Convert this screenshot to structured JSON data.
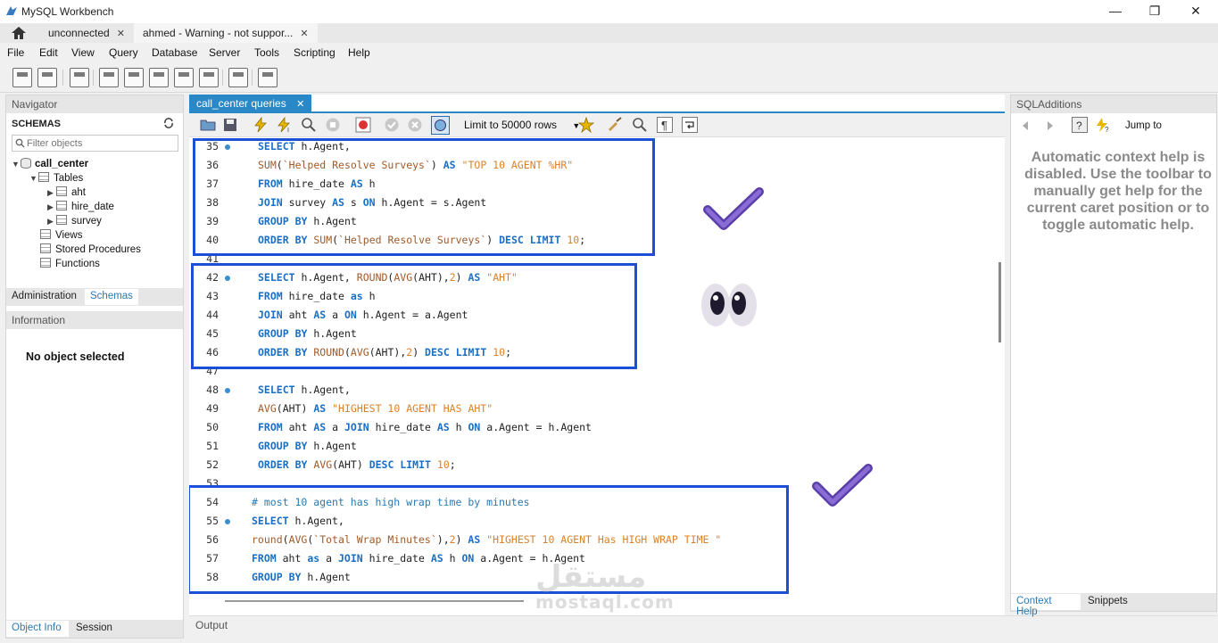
{
  "window": {
    "title": "MySQL Workbench",
    "controls": {
      "minimize": "—",
      "maximize": "❐",
      "close": "✕"
    }
  },
  "connection_tabs": [
    {
      "label": "unconnected",
      "close": "✕"
    },
    {
      "label": "ahmed - Warning - not suppor...",
      "close": "✕"
    }
  ],
  "menu": [
    "File",
    "Edit",
    "View",
    "Query",
    "Database",
    "Server",
    "Tools",
    "Scripting",
    "Help"
  ],
  "navigator": {
    "header": "Navigator",
    "schemas_label": "SCHEMAS",
    "filter_placeholder": "Filter objects",
    "schema": "call_center",
    "tables_label": "Tables",
    "tables": [
      "aht",
      "hire_date",
      "survey"
    ],
    "views_label": "Views",
    "procs_label": "Stored Procedures",
    "functions_label": "Functions",
    "tabs": [
      "Administration",
      "Schemas"
    ],
    "info_header": "Information",
    "no_object": "No object selected",
    "bottom_tabs": [
      "Object Info",
      "Session"
    ]
  },
  "editor": {
    "tab_label": "call_center queries",
    "tab_close": "✕",
    "limit_label": "Limit to 50000 rows",
    "output_label": "Output"
  },
  "code_lines": [
    {
      "n": "35",
      "dot": true,
      "text": "SELECT h.Agent,"
    },
    {
      "n": "36",
      "dot": false,
      "text": "SUM(`Helped Resolve Surveys`) AS \"TOP 10 AGENT %HR\""
    },
    {
      "n": "37",
      "dot": false,
      "text": "FROM hire_date AS h"
    },
    {
      "n": "38",
      "dot": false,
      "text": "JOIN survey AS s ON h.Agent = s.Agent"
    },
    {
      "n": "39",
      "dot": false,
      "text": "GROUP BY h.Agent"
    },
    {
      "n": "40",
      "dot": false,
      "text": "ORDER BY SUM(`Helped Resolve Surveys`) DESC LIMIT 10;"
    },
    {
      "n": "41",
      "dot": false,
      "text": ""
    },
    {
      "n": "42",
      "dot": true,
      "text": "SELECT h.Agent, ROUND(AVG(AHT),2) AS \"AHT\""
    },
    {
      "n": "43",
      "dot": false,
      "text": "FROM hire_date as h"
    },
    {
      "n": "44",
      "dot": false,
      "text": "JOIN aht AS a ON h.Agent = a.Agent"
    },
    {
      "n": "45",
      "dot": false,
      "text": "GROUP BY h.Agent"
    },
    {
      "n": "46",
      "dot": false,
      "text": "ORDER BY ROUND(AVG(AHT),2) DESC LIMIT 10;"
    },
    {
      "n": "47",
      "dot": false,
      "text": ""
    },
    {
      "n": "48",
      "dot": true,
      "text": "SELECT h.Agent,"
    },
    {
      "n": "49",
      "dot": false,
      "text": "AVG(AHT) AS \"HIGHEST 10 AGENT HAS AHT\""
    },
    {
      "n": "50",
      "dot": false,
      "text": "FROM aht AS a JOIN hire_date AS h ON a.Agent = h.Agent"
    },
    {
      "n": "51",
      "dot": false,
      "text": "GROUP BY h.Agent"
    },
    {
      "n": "52",
      "dot": false,
      "text": "ORDER BY AVG(AHT) DESC LIMIT 10;"
    },
    {
      "n": "53",
      "dot": false,
      "text": ""
    },
    {
      "n": "54",
      "dot": false,
      "text": "# most 10 agent has high wrap time by minutes"
    },
    {
      "n": "55",
      "dot": true,
      "text": "SELECT h.Agent,"
    },
    {
      "n": "56",
      "dot": false,
      "text": "round(AVG(`Total Wrap Minutes`),2) AS \"HIGHEST 10 AGENT Has HIGH WRAP TIME \""
    },
    {
      "n": "57",
      "dot": false,
      "text": "FROM aht as a JOIN hire_date AS h ON a.Agent = h.Agent"
    },
    {
      "n": "58",
      "dot": false,
      "text": "GROUP BY h.Agent"
    }
  ],
  "sql_additions": {
    "header": "SQLAdditions",
    "jump_to": "Jump to",
    "help_text": "Automatic context help is disabled. Use the toolbar to manually get help for the current caret position or to toggle automatic help.",
    "tabs": [
      "Context Help",
      "Snippets"
    ]
  },
  "watermark": {
    "arabic": "مستقل",
    "latin": "mostaql.com"
  },
  "colors": {
    "accent": "#2a88c6",
    "highlight_box": "#1a4fd6",
    "keyword": "#1a6fc5",
    "string": "#d9822b"
  }
}
